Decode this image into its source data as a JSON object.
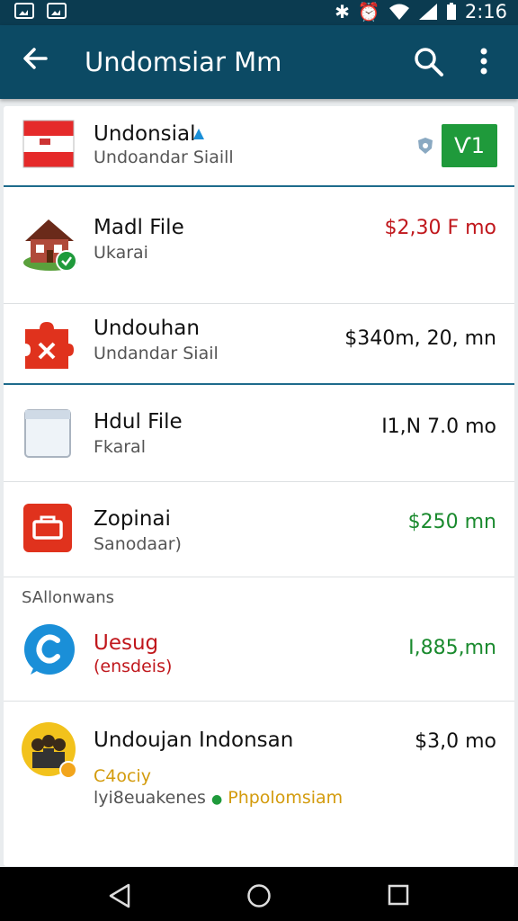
{
  "status_bar": {
    "time": "2:16"
  },
  "app_bar": {
    "title": "Undomsiar Mm"
  },
  "items": [
    {
      "title": "Undonsial",
      "subtitle": "Undoandar Siaill",
      "action": "Ѵ1"
    },
    {
      "title": "Madl File",
      "subtitle": "Ukarai",
      "price": "$2,30 F mo",
      "price_color": "#c0171c"
    },
    {
      "title": "Undouhan",
      "subtitle": "Undandar Siail",
      "price": "$340m, 20, mn",
      "price_color": "#111111"
    },
    {
      "title": "Hdul File",
      "subtitle": "Fkaral",
      "price": "I1,N 7.0 mo",
      "price_color": "#111111"
    },
    {
      "title": "Zopinai",
      "subtitle": "Sanodaar)",
      "price": "$250 mn",
      "price_color": "#1a8a2e"
    },
    {
      "title": "Uesug",
      "subtitle": "(ensdeis)",
      "price": "I,885,mn",
      "price_color": "#1a8a2e"
    },
    {
      "title": "Undoujan Indonsan",
      "subtitle": "C4ociy",
      "extra_a": "lyi8euakenes",
      "extra_b": "Phpolomsiam",
      "price": "$3,0 mo",
      "price_color": "#111111"
    }
  ],
  "section_header": "SAllonwans",
  "colors": {
    "appbar": "#0c4a64",
    "status": "#0b3b50",
    "green": "#1f9a3b",
    "red": "#e0321d",
    "blue": "#1a8fd8"
  },
  "icons": [
    "back-arrow-icon",
    "search-icon",
    "more-vert-icon",
    "flag-icon",
    "house-icon",
    "puzzle-icon",
    "box-icon",
    "briefcase-icon",
    "chat-icon",
    "people-icon"
  ]
}
